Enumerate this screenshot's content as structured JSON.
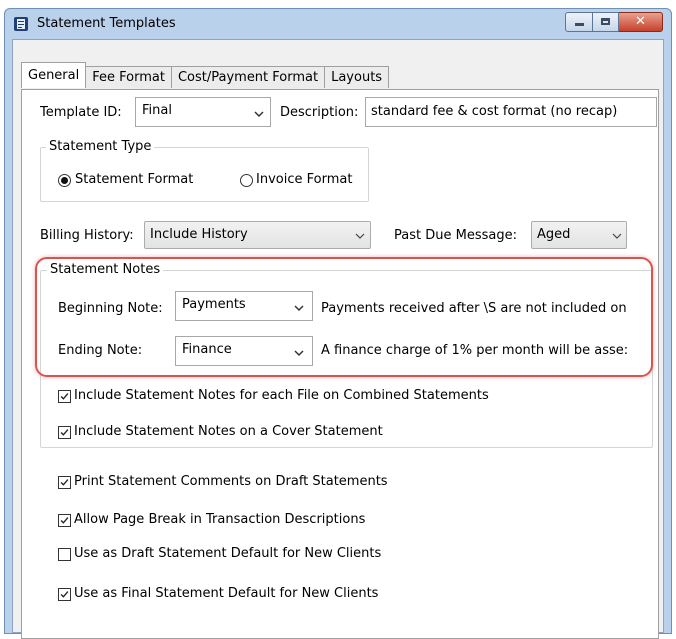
{
  "window": {
    "title": "Statement Templates",
    "close_glyph": "✕",
    "icons": {
      "app": "statement-templates-app-icon",
      "minimize": "minimize-icon",
      "maximize": "maximize-icon",
      "close": "close-icon"
    }
  },
  "tabs": [
    {
      "label": "General",
      "active": true
    },
    {
      "label": "Fee Format",
      "active": false
    },
    {
      "label": "Cost/Payment Format",
      "active": false
    },
    {
      "label": "Layouts",
      "active": false
    }
  ],
  "template": {
    "id_label": "Template ID:",
    "id_value": "Final",
    "description_label": "Description:",
    "description_value": "standard fee & cost format (no recap)"
  },
  "statement_type": {
    "legend": "Statement Type",
    "options": [
      {
        "label": "Statement Format",
        "selected": true
      },
      {
        "label": "Invoice Format",
        "selected": false
      }
    ]
  },
  "billing_history": {
    "label": "Billing History:",
    "value": "Include History"
  },
  "past_due": {
    "label": "Past Due Message:",
    "value": "Aged"
  },
  "statement_notes": {
    "legend": "Statement Notes",
    "beginning": {
      "label": "Beginning Note:",
      "value": "Payments",
      "text": "Payments received after \\S are not included on"
    },
    "ending": {
      "label": "Ending Note:",
      "value": "Finance",
      "text": "A finance charge of 1% per month will be asse:"
    },
    "checkboxes": [
      {
        "label": "Include Statement Notes for each File on Combined Statements",
        "checked": true
      },
      {
        "label": "Include Statement Notes on a Cover Statement",
        "checked": true
      }
    ]
  },
  "options": [
    {
      "label": "Print Statement Comments on Draft Statements",
      "checked": true
    },
    {
      "label": "Allow Page Break in Transaction Descriptions",
      "checked": true
    },
    {
      "label": "Use as Draft Statement Default for New Clients",
      "checked": false
    },
    {
      "label": "Use as Final Statement Default for New Clients",
      "checked": true
    }
  ],
  "colors": {
    "highlight": "#d9534f",
    "titlebar": "#b9d1ea",
    "close_button": "#c7412b"
  }
}
